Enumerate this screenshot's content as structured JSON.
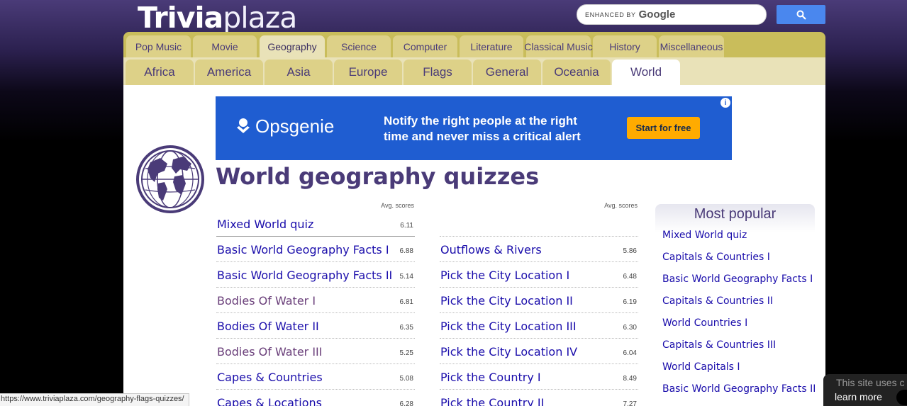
{
  "logo": {
    "part1": "Trivia",
    "part2": "plaza"
  },
  "search": {
    "enhanced_by": "ENHANCED BY",
    "google": "Google"
  },
  "main_tabs": [
    {
      "label": "Pop Music",
      "active": false
    },
    {
      "label": "Movie",
      "active": false
    },
    {
      "label": "Geography",
      "active": true
    },
    {
      "label": "Science",
      "active": false
    },
    {
      "label": "Computer",
      "active": false
    },
    {
      "label": "Literature",
      "active": false
    },
    {
      "label": "Classical Music",
      "active": false
    },
    {
      "label": "History",
      "active": false
    },
    {
      "label": "Miscellaneous",
      "active": false
    }
  ],
  "sub_tabs": [
    {
      "label": "Africa",
      "active": false
    },
    {
      "label": "America",
      "active": false
    },
    {
      "label": "Asia",
      "active": false
    },
    {
      "label": "Europe",
      "active": false
    },
    {
      "label": "Flags",
      "active": false
    },
    {
      "label": "General",
      "active": false
    },
    {
      "label": "Oceania",
      "active": false
    },
    {
      "label": "World",
      "active": true
    }
  ],
  "ad": {
    "brand": "Opsgenie",
    "line1": "Notify the right people at the right",
    "line2": "time and never miss a critical alert",
    "cta": "Start for free",
    "info": "i"
  },
  "page_title": "World geography quizzes",
  "avg_scores_label": "Avg. scores",
  "quizzes_left": [
    {
      "name": "Mixed World quiz",
      "score": "6.11",
      "visited": false
    },
    {
      "name": "Basic World Geography Facts I",
      "score": "6.88",
      "visited": false
    },
    {
      "name": "Basic World Geography Facts II",
      "score": "5.14",
      "visited": false
    },
    {
      "name": "Bodies Of Water I",
      "score": "6.81",
      "visited": true
    },
    {
      "name": "Bodies Of Water II",
      "score": "6.35",
      "visited": false
    },
    {
      "name": "Bodies Of Water III",
      "score": "5.25",
      "visited": true
    },
    {
      "name": "Capes & Countries",
      "score": "5.08",
      "visited": false
    },
    {
      "name": "Capes & Locations",
      "score": "6.28",
      "visited": false
    }
  ],
  "quizzes_right": [
    {
      "name": "Outflows & Rivers",
      "score": "5.86",
      "visited": false
    },
    {
      "name": "Pick the City Location I",
      "score": "6.48",
      "visited": false
    },
    {
      "name": "Pick the City Location II",
      "score": "6.19",
      "visited": false
    },
    {
      "name": "Pick the City Location III",
      "score": "6.30",
      "visited": false
    },
    {
      "name": "Pick the City Location IV",
      "score": "6.04",
      "visited": false
    },
    {
      "name": "Pick the Country I",
      "score": "8.49",
      "visited": false
    },
    {
      "name": "Pick the Country II",
      "score": "7.27",
      "visited": false
    }
  ],
  "most_popular": {
    "title": "Most popular",
    "items": [
      "Mixed World quiz",
      "Capitals & Countries I",
      "Basic World Geography Facts I",
      "Capitals & Countries II",
      "World Countries I",
      "Capitals & Countries III",
      "World Capitals I",
      "Basic World Geography Facts II"
    ]
  },
  "status_url": "https://www.triviaplaza.com/geography-flags-quizzes/",
  "cookie": {
    "text": "This site uses c",
    "learn_more": "learn more"
  },
  "colors": {
    "purple": "#4a3b78",
    "tab_gold": "#c9bd5b",
    "link": "#1a0dab",
    "ad_blue": "#1f5dd1"
  }
}
